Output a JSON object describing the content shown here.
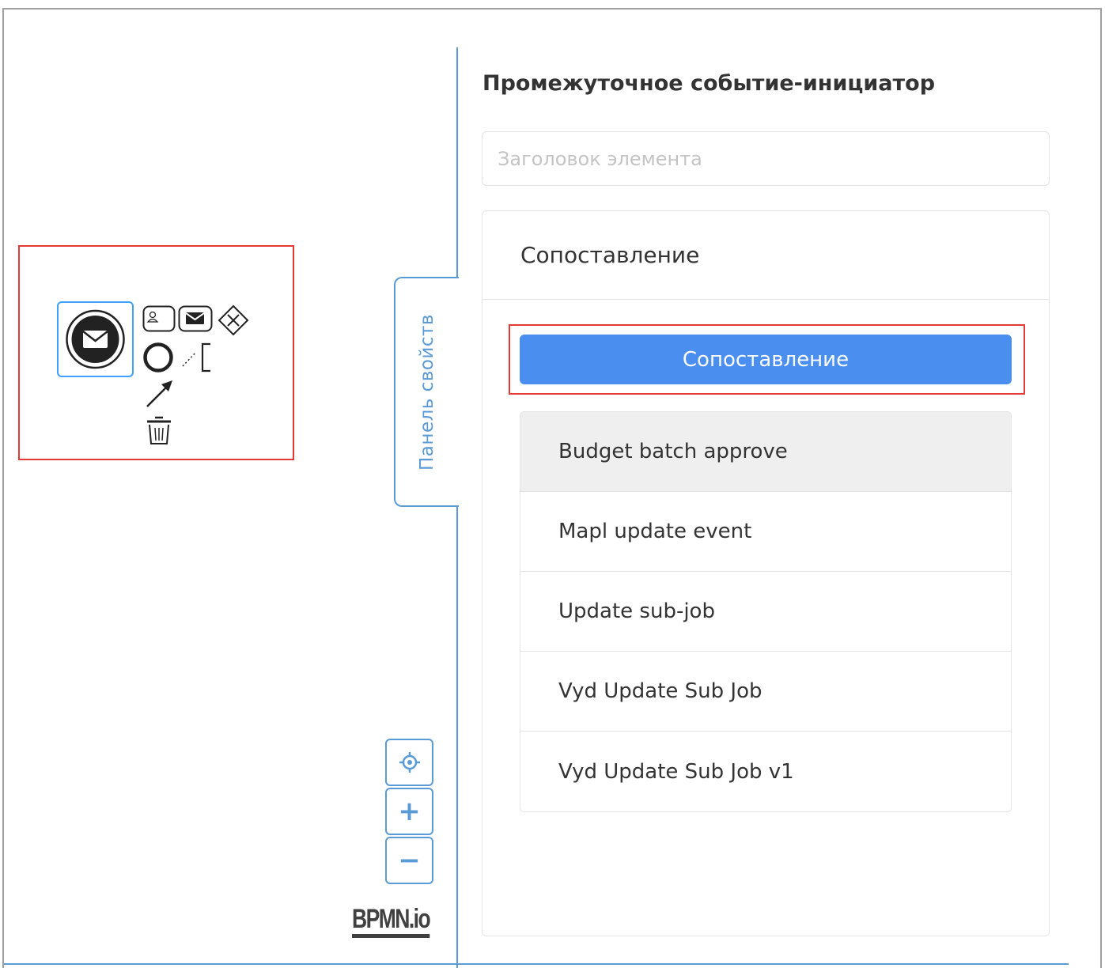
{
  "canvas": {
    "context_pad": {
      "icons": [
        "user-task-icon",
        "message-event-icon",
        "gateway-icon",
        "end-event-icon",
        "text-annotation-icon",
        "connect-arrow-icon",
        "delete-icon"
      ]
    },
    "properties_tab_label": "Панель свойств",
    "zoom": {
      "fit_icon": "crosshair-icon",
      "zoom_in_label": "+",
      "zoom_out_label": "−"
    },
    "logo_text": "BPMN.io"
  },
  "panel": {
    "title": "Промежуточное событие-инициатор",
    "title_input": {
      "value": "",
      "placeholder": "Заголовок элемента"
    },
    "section_title": "Сопоставление",
    "mapping_button_label": "Сопоставление",
    "items": [
      {
        "label": "Budget batch approve",
        "active": true
      },
      {
        "label": "Mapl update event"
      },
      {
        "label": "Update sub-job"
      },
      {
        "label": "Vyd Update Sub Job"
      },
      {
        "label": "Vyd Update Sub Job v1"
      }
    ]
  },
  "colors": {
    "accent": "#5b9bd5",
    "primary_button": "#4a8ef0",
    "highlight": "#e53935",
    "selection": "#3ea0ff"
  }
}
